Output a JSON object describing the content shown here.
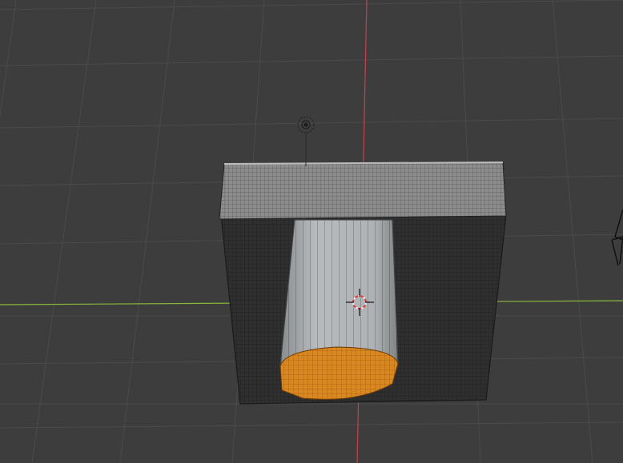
{
  "app": {
    "name": "3D Viewport"
  },
  "scene": {
    "view": "perspective-from-above",
    "background_color": "#3d3d3d",
    "grid_color": "#4b4b4b",
    "axis_x_color": "#8ab83a",
    "axis_y_color": "#c9404d",
    "selection_color": "#e0891f",
    "mesh_dark_color": "#303030",
    "mesh_light_color": "#a9adaf",
    "objects": [
      {
        "name": "voxel-block",
        "icon": "mesh-object-icon"
      },
      {
        "name": "voxel-cylinder",
        "icon": "mesh-object-icon",
        "selected_face": "bottom"
      },
      {
        "name": "light",
        "icon": "point-light-icon"
      },
      {
        "name": "camera",
        "icon": "camera-icon"
      },
      {
        "name": "3d-cursor",
        "icon": "3d-cursor-icon"
      }
    ]
  }
}
